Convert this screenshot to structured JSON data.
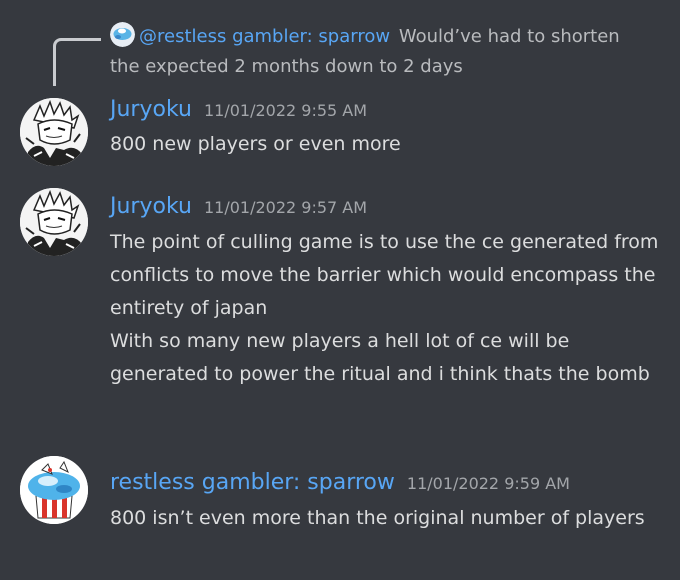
{
  "reply": {
    "author": "@restless gambler: sparrow",
    "text": "Would’ve had to shorten the expected 2 months down to 2 days"
  },
  "messages": [
    {
      "author": "Juryoku",
      "timestamp": "11/01/2022 9:55 AM",
      "lines": [
        "800 new players or even more"
      ]
    },
    {
      "author": "Juryoku",
      "timestamp": "11/01/2022 9:57 AM",
      "lines": [
        "The point of culling game is to use the ce generated from conflicts to move the barrier which would encompass the entirety of japan",
        "With so many new players a hell lot of ce will be generated to power the ritual and i think thats the bomb"
      ]
    },
    {
      "author": "restless gambler: sparrow",
      "timestamp": "11/01/2022 9:59 AM",
      "lines": [
        "800 isn’t even more than the original number of players"
      ]
    }
  ],
  "colors": {
    "background": "#36393f",
    "author": "#58a6f5",
    "message_text": "#dcddde",
    "timestamp": "#a3a6aa",
    "reply_line": "#c9cbcf"
  },
  "icons": {
    "juryoku_avatar": "manga-character-avatar",
    "sparrow_avatar": "gift-box-avatar"
  }
}
